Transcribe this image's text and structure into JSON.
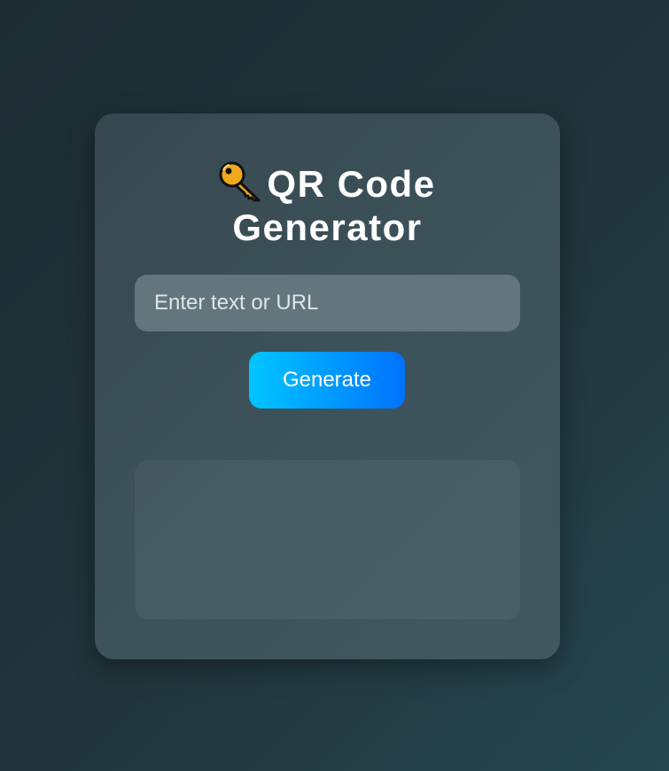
{
  "app": {
    "title_icon": "key-icon",
    "title_line1": "QR Code",
    "title_line2": "Generator"
  },
  "input": {
    "value": "",
    "placeholder": "Enter text or URL"
  },
  "actions": {
    "generate_label": "Generate"
  },
  "colors": {
    "page_background": "#1f3038",
    "card_background": "#3b4f57",
    "input_background": "#63767d",
    "button_gradient_start": "#00c6ff",
    "button_gradient_end": "#0072ff",
    "text": "#ffffff",
    "key_icon": "#f0a81c"
  }
}
